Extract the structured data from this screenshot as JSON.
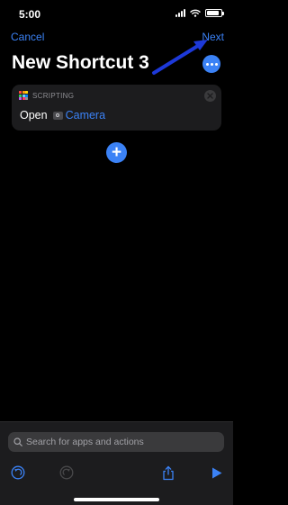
{
  "status_bar": {
    "time": "5:00",
    "battery_level": 0.85
  },
  "nav": {
    "cancel_label": "Cancel",
    "next_label": "Next"
  },
  "title": "New Shortcut 3",
  "action_card": {
    "category": "SCRIPTING",
    "verb": "Open",
    "parameter": "Camera"
  },
  "search": {
    "placeholder": "Search for apps and actions",
    "value": ""
  },
  "icons": {
    "more": "ellipsis-icon",
    "close": "close-icon",
    "add": "plus-icon",
    "search": "search-icon",
    "undo": "undo-icon",
    "redo": "redo-icon",
    "share": "share-icon",
    "play": "play-icon",
    "annotation": "arrow-annotation"
  },
  "colors": {
    "accent": "#3b82f6",
    "arrow": "#1d39d9",
    "card_background": "#1c1c1e",
    "background": "#000000"
  }
}
